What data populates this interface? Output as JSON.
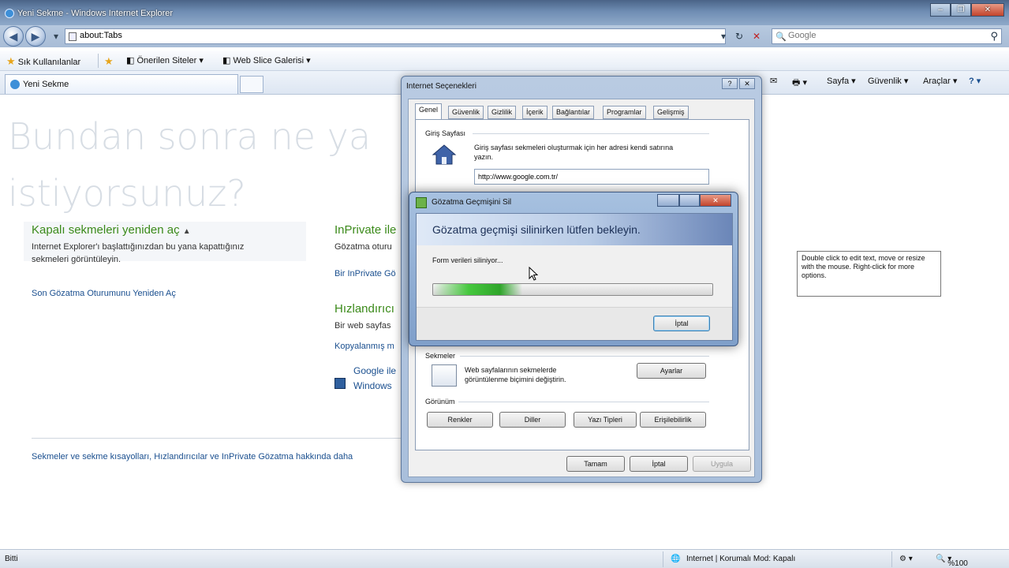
{
  "window": {
    "title": "Yeni Sekme - Windows Internet Explorer",
    "minimize_glyph": "–",
    "maximize_glyph": "❐",
    "close_glyph": "✕"
  },
  "addressbar": {
    "url": "about:Tabs",
    "dropdown_glyph": "▾",
    "refresh_glyph": "↻",
    "stop_glyph": "✕",
    "back_glyph": "◀",
    "forward_glyph": "▶"
  },
  "search": {
    "placeholder": "Google",
    "button_glyph": "⚲"
  },
  "favorites": {
    "label": "Sık Kullanılanlar",
    "items": [
      "Önerilen Siteler ▾",
      "Web Slice Galerisi ▾"
    ]
  },
  "tabs": {
    "active_label": "Yeni Sekme"
  },
  "commandbar": {
    "page": "Sayfa ▾",
    "safety": "Güvenlik ▾",
    "tools": "Araçlar ▾",
    "help": "? ▾"
  },
  "page": {
    "headline_line1": "Bundan sonra ne ya",
    "headline_line2": "istiyorsunuz?",
    "closed_tabs_title": "Kapalı sekmeleri yeniden aç",
    "closed_tabs_caret": "▲",
    "closed_tabs_desc_1": "Internet Explorer'ı başlattığınızdan bu yana kapattığınız",
    "closed_tabs_desc_2": "sekmeleri görüntüleyin.",
    "reopen_last_session": "Son Gözatma Oturumunu Yeniden Aç",
    "inprivate_title": "InPrivate ile",
    "inprivate_desc": "Gözatma oturu",
    "inprivate_link": "Bir InPrivate Gö",
    "accelerators_title": "Hızlandırıcı",
    "accelerators_desc": "Bir web sayfas",
    "copied_link": "Kopyalanmış m",
    "google_line1": "Google ile",
    "google_line2": "Windows",
    "footer_text": "Sekmeler ve sekme kısayolları, Hızlandırıcılar ve InPrivate Gözatma hakkında daha"
  },
  "options_dialog": {
    "title": "Internet Seçenekleri",
    "help_glyph": "?",
    "close_glyph": "✕",
    "tabs": [
      "Genel",
      "Güvenlik",
      "Gizlilik",
      "İçerik",
      "Bağlantılar",
      "Programlar",
      "Gelişmiş"
    ],
    "home_group": "Giriş Sayfası",
    "home_desc_1": "Giriş sayfası sekmeleri oluşturmak için her adresi kendi satırına",
    "home_desc_2": "yazın.",
    "home_url": "http://www.google.com.tr/",
    "tabs_group": "Sekmeler",
    "tabs_desc_1": "Web sayfalarının sekmelerde",
    "tabs_desc_2": "görüntülenme biçimini değiştirin.",
    "settings_button": "Ayarlar",
    "appearance_group": "Görünüm",
    "colors_button": "Renkler",
    "languages_button": "Diller",
    "fonts_button": "Yazı Tipleri",
    "accessibility_button": "Erişilebilirlik",
    "ok_button": "Tamam",
    "cancel_button": "İptal",
    "apply_button": "Uygula"
  },
  "delete_dialog": {
    "title": "Gözatma Geçmişini Sil",
    "close_glyph": "✕",
    "banner": "Gözatma geçmişi silinirken lütfen bekleyin.",
    "status": "Form verileri siliniyor...",
    "progress": 0.32,
    "cancel_button": "İptal"
  },
  "tooltip": {
    "text": "Double click to edit text, move or resize with the mouse. Right-click for more options."
  },
  "statusbar": {
    "left": "Bitti",
    "zone": "Internet | Korumalı Mod: Kapalı",
    "zoom": "%100"
  },
  "colors": {
    "accent_green": "#3b8a1a",
    "progress_green": "#46c83e",
    "titlebar_blue": "#6f8db3"
  }
}
